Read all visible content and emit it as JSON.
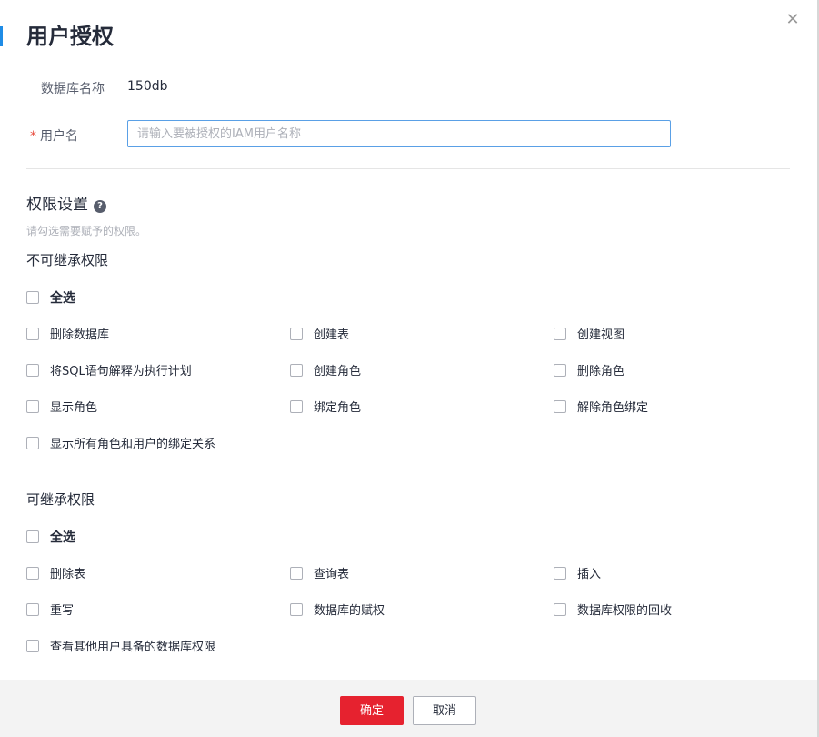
{
  "dialog": {
    "title": "用户授权",
    "close_icon": "close-icon"
  },
  "database": {
    "label": "数据库名称",
    "value": "150db"
  },
  "username": {
    "required_mark": "*",
    "label": "用户名",
    "value": "",
    "placeholder": "请输入要被授权的IAM用户名称"
  },
  "permissions": {
    "title": "权限设置",
    "help_icon": "question-circle-icon",
    "hint": "请勾选需要赋予的权限。",
    "non_inheritable": {
      "title": "不可继承权限",
      "select_all": "全选",
      "items": [
        "删除数据库",
        "创建表",
        "创建视图",
        "将SQL语句解释为执行计划",
        "创建角色",
        "删除角色",
        "显示角色",
        "绑定角色",
        "解除角色绑定",
        "显示所有角色和用户的绑定关系"
      ]
    },
    "inheritable": {
      "title": "可继承权限",
      "select_all": "全选",
      "items": [
        "删除表",
        "查询表",
        "插入",
        "重写",
        "数据库的赋权",
        "数据库权限的回收",
        "查看其他用户具备的数据库权限"
      ]
    }
  },
  "footer": {
    "confirm_label": "确定",
    "cancel_label": "取消",
    "confirm_color": "#e6222f"
  }
}
